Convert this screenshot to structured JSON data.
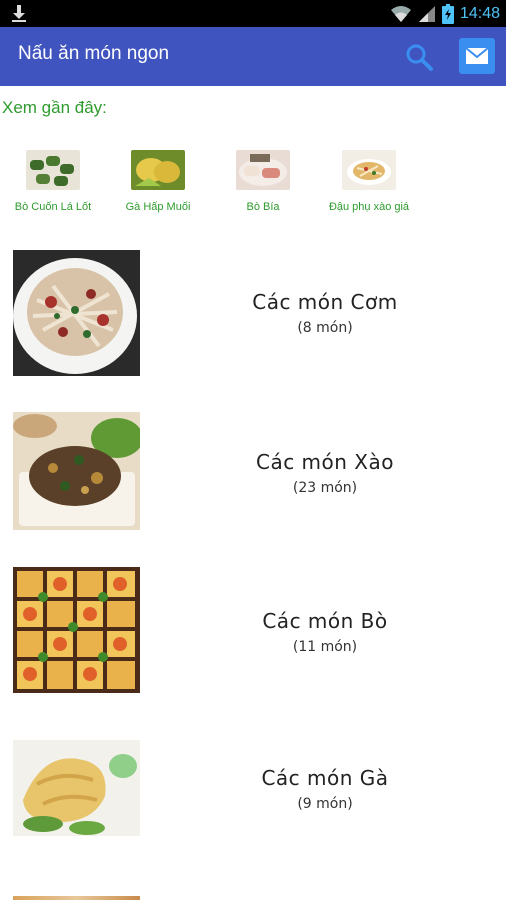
{
  "status_bar": {
    "time": "14:48",
    "icons": [
      "download-icon",
      "wifi-icon",
      "signal-icon",
      "battery-icon"
    ]
  },
  "app_bar": {
    "title": "Nấu ăn món ngon",
    "icons": [
      "search-icon",
      "mail-icon"
    ]
  },
  "recent": {
    "label": "Xem gần đây:",
    "items": [
      {
        "name": "Bò Cuốn Lá Lốt"
      },
      {
        "name": "Gà Hấp Muối"
      },
      {
        "name": "Bò Bía"
      },
      {
        "name": "Đậu phụ xào giá"
      }
    ]
  },
  "categories": [
    {
      "title": "Các món Cơm",
      "count": "(8 món)"
    },
    {
      "title": "Các món Xào",
      "count": "(23 món)"
    },
    {
      "title": "Các món Bò",
      "count": "(11 món)"
    },
    {
      "title": "Các món Gà",
      "count": "(9 món)"
    }
  ],
  "colors": {
    "app_bar": "#4054bf",
    "accent_green": "#2e9b2e",
    "status_icon": "#4fc3f7",
    "mail_button": "#3a8ef0"
  }
}
